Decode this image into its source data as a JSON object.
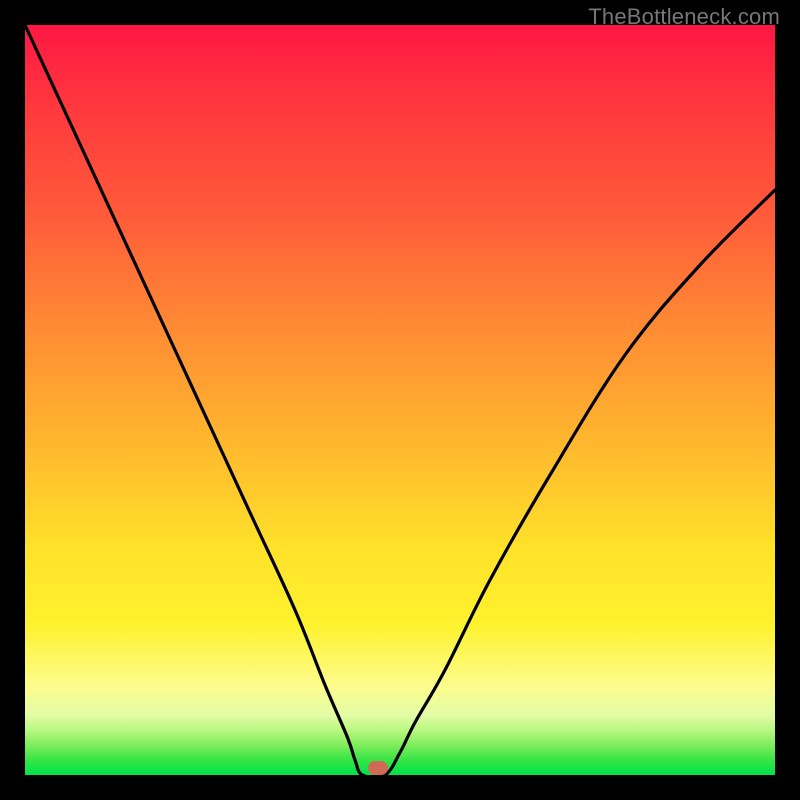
{
  "watermark": "TheBottleneck.com",
  "chart_data": {
    "type": "line",
    "title": "",
    "xlabel": "",
    "ylabel": "",
    "xlim": [
      0,
      100
    ],
    "ylim": [
      0,
      100
    ],
    "grid": false,
    "legend": false,
    "series": [
      {
        "name": "bottleneck-curve",
        "x": [
          0,
          6,
          12,
          18,
          24,
          30,
          36,
          40,
          43,
          44,
          45,
          48,
          50,
          52,
          56,
          62,
          70,
          80,
          90,
          100
        ],
        "values": [
          100,
          87,
          74,
          61,
          48,
          35,
          22,
          12,
          5,
          2,
          0,
          0,
          3,
          7,
          14,
          26,
          40,
          56,
          68,
          78
        ]
      }
    ],
    "marker": {
      "x": 47,
      "y": 1
    },
    "colors": {
      "curve": "#000000",
      "marker": "#cf6b55",
      "gradient_top": "#ff1744",
      "gradient_bottom": "#00e24b"
    }
  }
}
